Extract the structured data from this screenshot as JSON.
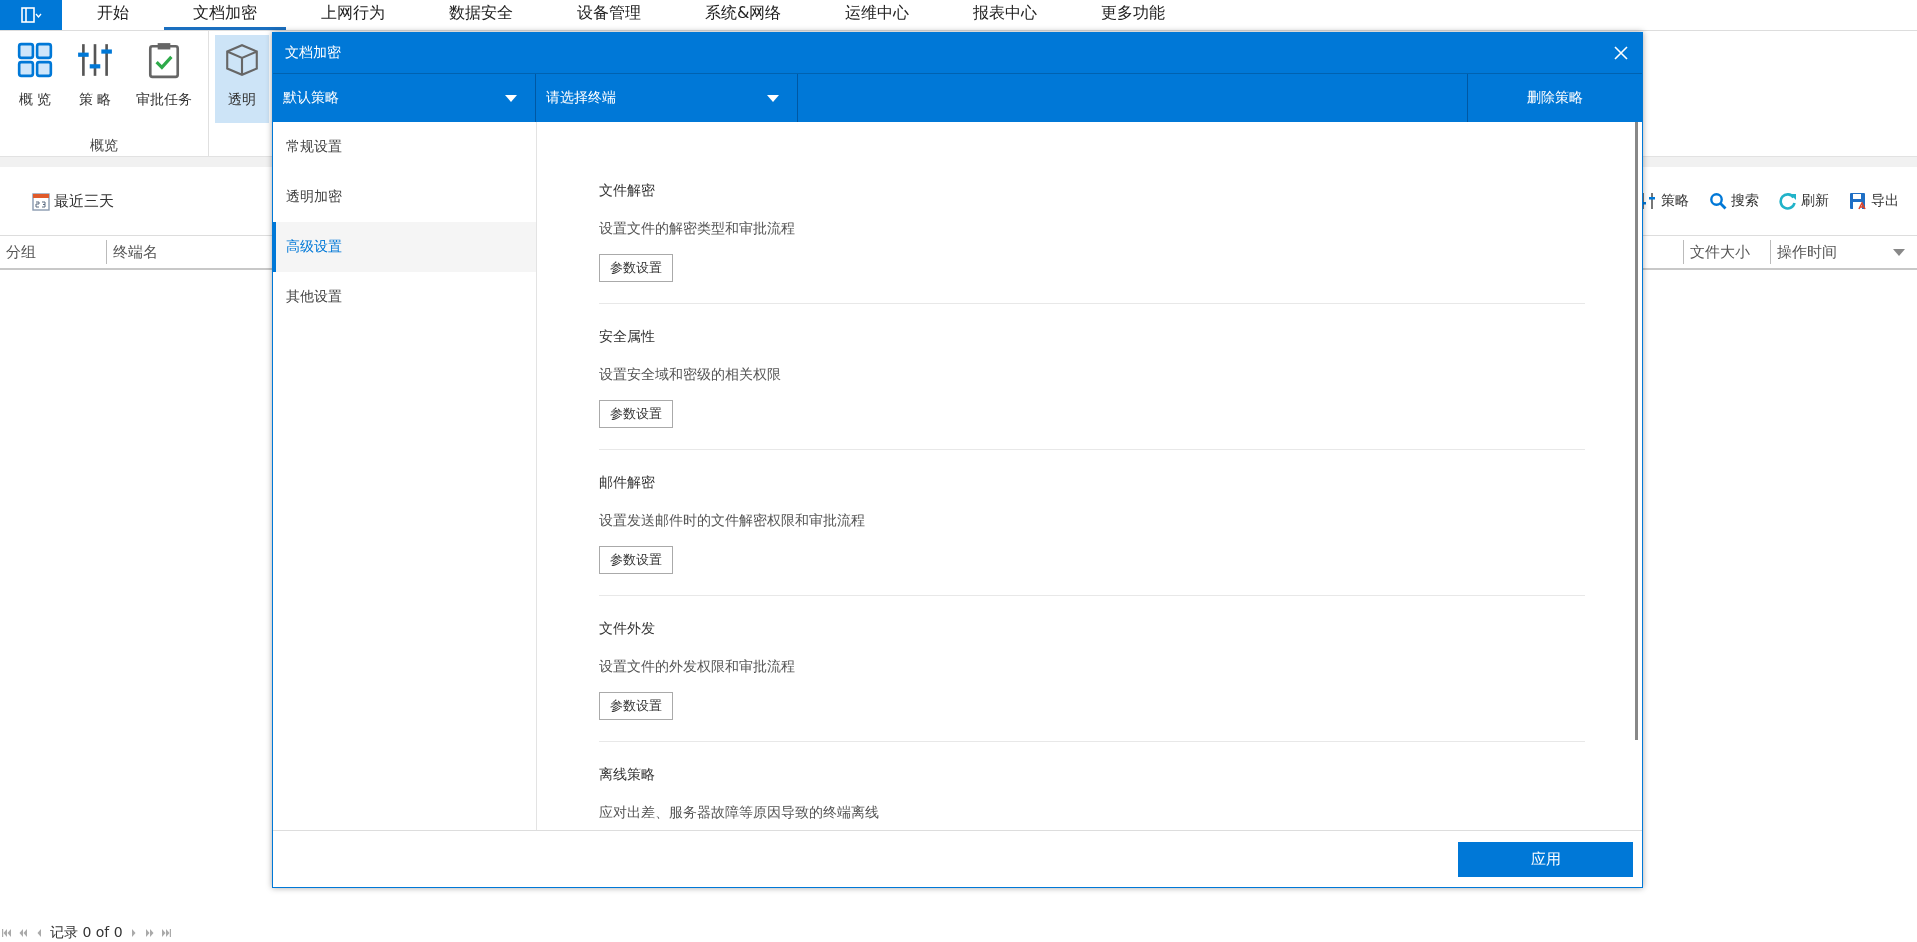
{
  "menu": {
    "tabs": [
      {
        "label": "开始",
        "selected": false
      },
      {
        "label": "文档加密",
        "selected": true
      },
      {
        "label": "上网行为",
        "selected": false
      },
      {
        "label": "数据安全",
        "selected": false
      },
      {
        "label": "设备管理",
        "selected": false
      },
      {
        "label": "系统&网络",
        "selected": false
      },
      {
        "label": "运维中心",
        "selected": false
      },
      {
        "label": "报表中心",
        "selected": false
      },
      {
        "label": "更多功能",
        "selected": false
      }
    ]
  },
  "ribbon": {
    "buttons": [
      {
        "label": "概 览",
        "kind": "grid",
        "selected": false
      },
      {
        "label": "策 略",
        "kind": "sliders",
        "selected": false
      },
      {
        "label": "审批任务",
        "kind": "clipboard",
        "selected": false
      },
      {
        "label": "透明",
        "kind": "cube",
        "selected": true
      }
    ],
    "group_label": "概览"
  },
  "toolbar": {
    "date_range": "最近三天",
    "actions": [
      {
        "label": "策略",
        "kind": "sliders"
      },
      {
        "label": "搜索",
        "kind": "search"
      },
      {
        "label": "刷新",
        "kind": "refresh"
      },
      {
        "label": "导出",
        "kind": "export"
      }
    ]
  },
  "table": {
    "columns_left": [
      "分组",
      "终端名"
    ],
    "columns_right": [
      "文件大小",
      "操作时间"
    ]
  },
  "pager": {
    "text": "记录 0 of 0"
  },
  "dialog": {
    "title": "文档加密",
    "policy_select": "默认策略",
    "terminal_select": "请选择终端",
    "delete_button": "删除策略",
    "nav": [
      {
        "label": "常规设置",
        "selected": false
      },
      {
        "label": "透明加密",
        "selected": false
      },
      {
        "label": "高级设置",
        "selected": true
      },
      {
        "label": "其他设置",
        "selected": false
      }
    ],
    "sections": [
      {
        "title": "文件解密",
        "description": "设置文件的解密类型和审批流程",
        "button": "参数设置"
      },
      {
        "title": "安全属性",
        "description": "设置安全域和密级的相关权限",
        "button": "参数设置"
      },
      {
        "title": "邮件解密",
        "description": "设置发送邮件时的文件解密权限和审批流程",
        "button": "参数设置"
      },
      {
        "title": "文件外发",
        "description": "设置文件的外发权限和审批流程",
        "button": "参数设置"
      },
      {
        "title": "离线策略",
        "description": "应对出差、服务器故障等原因导致的终端离线"
      }
    ],
    "apply_button": "应用"
  }
}
